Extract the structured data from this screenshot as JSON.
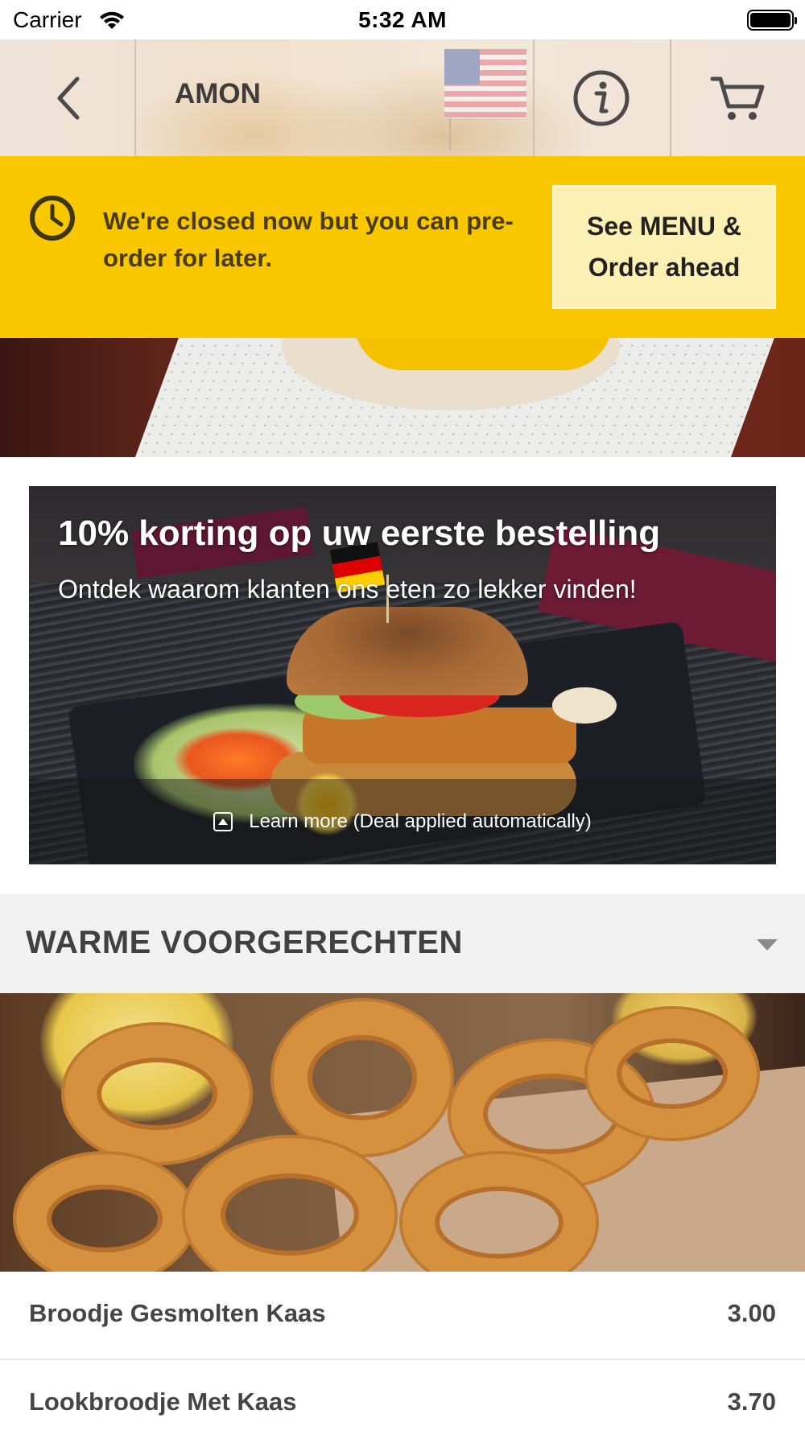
{
  "status_bar": {
    "carrier": "Carrier",
    "time": "5:32 AM"
  },
  "nav": {
    "title": "AMON"
  },
  "closed_banner": {
    "message": "We're closed now but you can pre-order for later.",
    "button_label": "See MENU & Order ahead"
  },
  "promo": {
    "title": "10% korting op uw eerste bestelling",
    "subtitle": "Ontdek waarom klanten ons eten zo lekker vinden!",
    "link_label": "Learn more (Deal applied automatically)"
  },
  "category": {
    "title": "WARME VOORGERECHTEN"
  },
  "menu_items": [
    {
      "name": "Broodje Gesmolten Kaas",
      "price": "3.00"
    },
    {
      "name": "Lookbroodje Met Kaas",
      "price": "3.70"
    }
  ],
  "colors": {
    "accent": "#f8c700",
    "button_bg": "#fdf0b4",
    "text_dark": "#454545"
  },
  "icons": [
    "wifi-icon",
    "battery-icon",
    "back-chevron-icon",
    "info-icon",
    "cart-icon",
    "clock-icon",
    "expand-icon",
    "caret-down-icon"
  ]
}
